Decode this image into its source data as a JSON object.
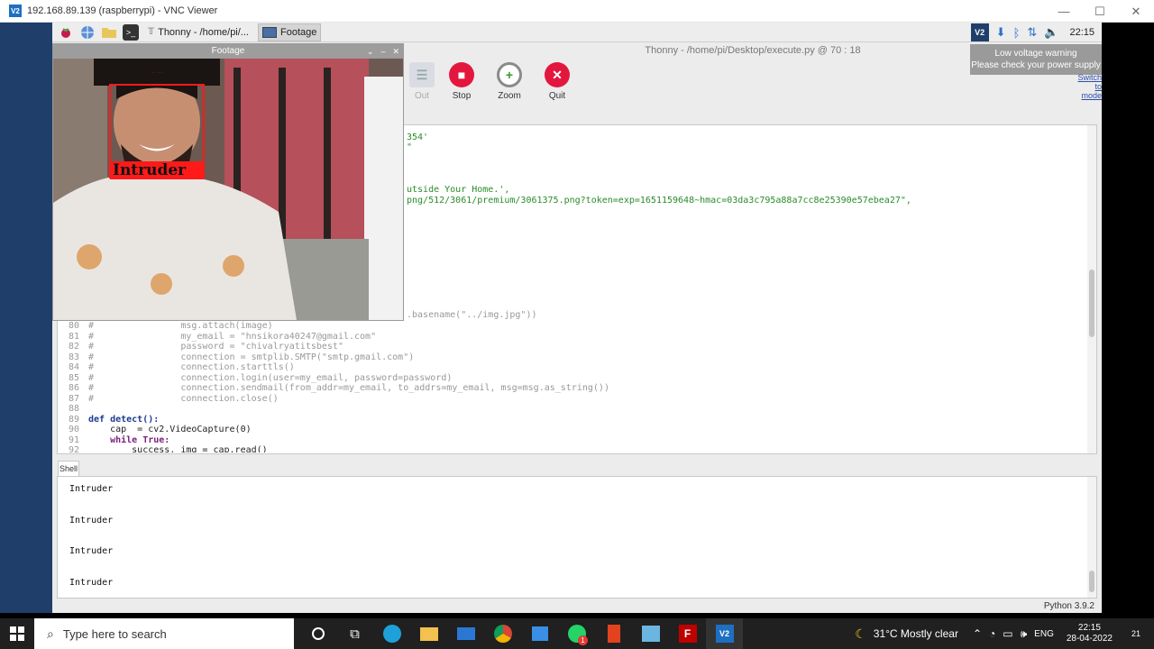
{
  "vnc": {
    "title": "192.168.89.139 (raspberrypi) - VNC Viewer",
    "logo": "V2",
    "minimize": "—",
    "maximize": "☐",
    "close": "✕"
  },
  "pi_panel": {
    "tasks": [
      {
        "label": "Thonny  -  /home/pi/..."
      },
      {
        "label": "Footage"
      }
    ],
    "tray_vc": "V2",
    "time": "22:15"
  },
  "tooltip": {
    "line1": "Low voltage warning",
    "line2": "Please check your power supply"
  },
  "thonny": {
    "title": "Thonny  -  /home/pi/Desktop/execute.py  @  70 : 18",
    "toolbar": {
      "out_label": "Out",
      "stop_label": "Stop",
      "zoom_label": "Zoom",
      "quit_label": "Quit"
    },
    "switch_mode": {
      "line1": "Switch to",
      "line2": "mode"
    },
    "editor_fragments": [
      "354'",
      "\"",
      "utside Your Home.',",
      "png/512/3061/premium/3061375.png?token=exp=1651159648~hmac=03da3c795a88a7cc8e25390e57ebea27\",",
      ".basename(\"../img.jpg\"))"
    ],
    "code_lines": [
      {
        "n": "80",
        "t": "#                msg.attach(image)"
      },
      {
        "n": "81",
        "t": "#                my_email = \"hnsikora40247@gmail.com\""
      },
      {
        "n": "82",
        "t": "#                password = \"chivalryatitsbest\""
      },
      {
        "n": "83",
        "t": "#                connection = smtplib.SMTP(\"smtp.gmail.com\")"
      },
      {
        "n": "84",
        "t": "#                connection.starttls()"
      },
      {
        "n": "85",
        "t": "#                connection.login(user=my_email, password=password)"
      },
      {
        "n": "86",
        "t": "#                connection.sendmail(from_addr=my_email, to_addrs=my_email, msg=msg.as_string())"
      },
      {
        "n": "87",
        "t": "#                connection.close()"
      },
      {
        "n": "88",
        "t": ""
      },
      {
        "n": "89",
        "t": "def detect():"
      },
      {
        "n": "90",
        "t": "    cap  = cv2.VideoCapture(0)"
      },
      {
        "n": "91",
        "t": "    while True:"
      },
      {
        "n": "92",
        "t": "        success, img = cap.read()"
      }
    ],
    "shell_tab": "Shell",
    "shell_lines": [
      "Intruder",
      "Intruder",
      "Intruder",
      "Intruder"
    ],
    "status": "Python 3.9.2"
  },
  "footage": {
    "title": "Footage",
    "label": "Intruder",
    "min": "⌄",
    "max": "–",
    "close": "✕"
  },
  "taskbar": {
    "search_placeholder": "Type here to search",
    "weather": "31°C  Mostly clear",
    "lang": "ENG",
    "time": "22:15",
    "date": "28-04-2022",
    "whatsapp_badge": "1",
    "notify_count": "21"
  }
}
